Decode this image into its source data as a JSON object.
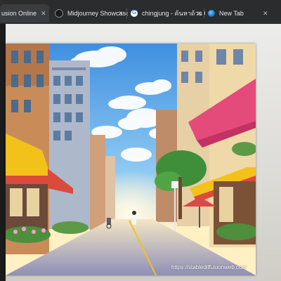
{
  "browser": {
    "tabs": [
      {
        "title": "usion Online",
        "favicon": "site-icon"
      },
      {
        "title": "Midjourney Showcase",
        "favicon": "midjourney-icon"
      },
      {
        "title": "chingjung - ค้นหาด้วย Google",
        "favicon": "google-icon"
      },
      {
        "title": "New Tab",
        "favicon": "edge-icon"
      }
    ],
    "close_glyph": "✕"
  },
  "artwork": {
    "watermark": "https://stablediffusionweb.com",
    "sky_color": "#5aa7e8",
    "awning_yellow": "#f2c21b",
    "awning_pink": "#e44a7a"
  }
}
